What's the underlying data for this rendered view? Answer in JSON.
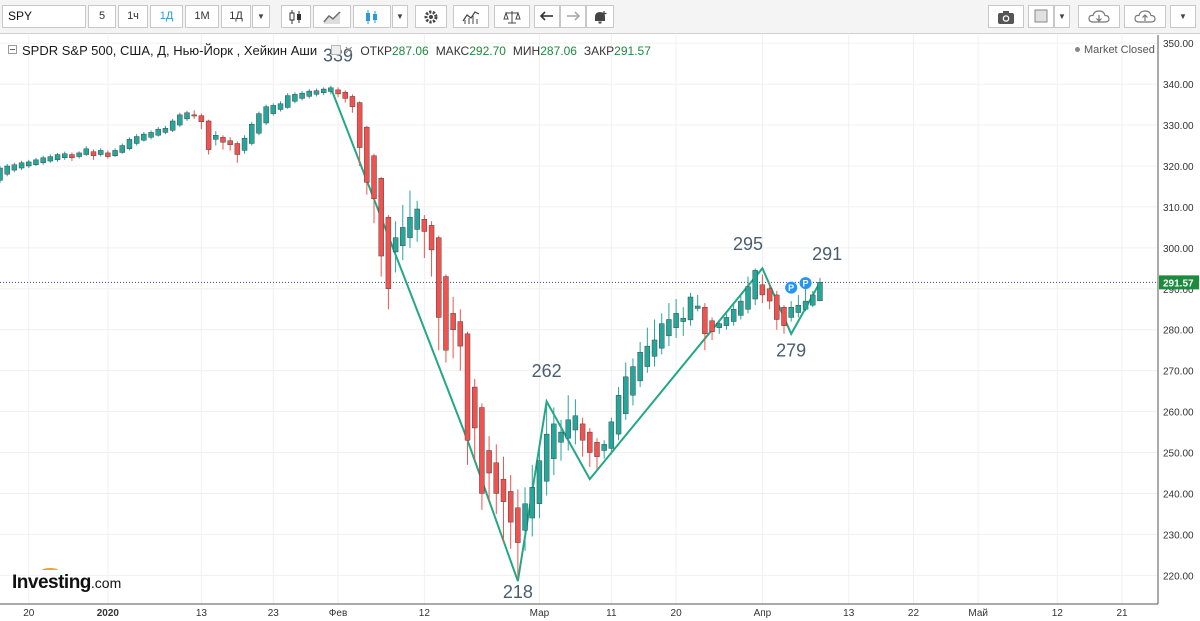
{
  "toolbar": {
    "symbol": "SPY",
    "intervals": [
      "5",
      "1ч",
      "1Д",
      "1М",
      "1Д"
    ],
    "active_interval": "1Д"
  },
  "legend": {
    "title": "SPDR S&P 500, США, Д, Нью-Йорк , Хейкин Аши",
    "open_label": "ОТКР",
    "open_value": "287.06",
    "high_label": "МАКС",
    "high_value": "292.70",
    "low_label": "МИН",
    "low_value": "287.06",
    "close_label": "ЗАКР",
    "close_value": "291.57"
  },
  "market_status": "Market Closed",
  "logo": {
    "name": "Investing",
    "suffix": ".com"
  },
  "colors": {
    "up": "#26a69a",
    "down": "#ef5350",
    "wave_line": "#22a884",
    "price_marker": "#1e8a3d",
    "annotation_text": "#4a5d6e",
    "badge": "#2196f3"
  },
  "chart_data": {
    "type": "candlestick",
    "style": "Heikin Ashi",
    "ylim": [
      213,
      352
    ],
    "y_ticks": [
      220,
      230,
      240,
      250,
      260,
      270,
      280,
      290,
      300,
      310,
      320,
      330,
      340,
      350
    ],
    "y_tick_labels": [
      "220.00",
      "230.00",
      "240.00",
      "250.00",
      "260.00",
      "270.00",
      "280.00",
      "290.00",
      "300.00",
      "310.00",
      "320.00",
      "330.00",
      "340.00",
      "350.00"
    ],
    "x_ticks": [
      {
        "label": "20",
        "day": 0
      },
      {
        "label": "2020",
        "day": 11,
        "bold": true
      },
      {
        "label": "13",
        "day": 24
      },
      {
        "label": "23",
        "day": 34
      },
      {
        "label": "Фев",
        "day": 43
      },
      {
        "label": "12",
        "day": 55
      },
      {
        "label": "Мар",
        "day": 71
      },
      {
        "label": "11",
        "day": 81
      },
      {
        "label": "20",
        "day": 90
      },
      {
        "label": "Апр",
        "day": 102
      },
      {
        "label": "13",
        "day": 114
      },
      {
        "label": "22",
        "day": 123
      },
      {
        "label": "Май",
        "day": 132
      },
      {
        "label": "12",
        "day": 143
      },
      {
        "label": "21",
        "day": 152
      }
    ],
    "x_range_days": [
      -4,
      157
    ],
    "candles": [
      {
        "d": -4,
        "o": 316.5,
        "c": 319.5,
        "h": 320.0,
        "l": 315.8
      },
      {
        "d": -3,
        "o": 318.0,
        "c": 320.0,
        "h": 320.5,
        "l": 317.5
      },
      {
        "d": -2,
        "o": 319.0,
        "c": 320.3,
        "h": 320.8,
        "l": 318.5
      },
      {
        "d": -1,
        "o": 319.5,
        "c": 320.8,
        "h": 321.3,
        "l": 319.0
      },
      {
        "d": 0,
        "o": 320.0,
        "c": 321.0,
        "h": 321.5,
        "l": 319.5
      },
      {
        "d": 1,
        "o": 320.3,
        "c": 321.5,
        "h": 322.0,
        "l": 320.0
      },
      {
        "d": 2,
        "o": 320.8,
        "c": 322.0,
        "h": 322.5,
        "l": 320.3
      },
      {
        "d": 3,
        "o": 321.2,
        "c": 322.3,
        "h": 322.8,
        "l": 320.8
      },
      {
        "d": 4,
        "o": 321.5,
        "c": 322.8,
        "h": 323.2,
        "l": 321.0
      },
      {
        "d": 5,
        "o": 322.0,
        "c": 323.0,
        "h": 323.5,
        "l": 321.5
      },
      {
        "d": 6,
        "o": 322.8,
        "c": 322.0,
        "h": 323.3,
        "l": 321.2
      },
      {
        "d": 7,
        "o": 322.3,
        "c": 323.2,
        "h": 323.6,
        "l": 321.8
      },
      {
        "d": 8,
        "o": 322.8,
        "c": 324.2,
        "h": 324.8,
        "l": 322.5
      },
      {
        "d": 9,
        "o": 323.5,
        "c": 322.5,
        "h": 324.0,
        "l": 321.5
      },
      {
        "d": 10,
        "o": 322.8,
        "c": 323.8,
        "h": 324.3,
        "l": 322.3
      },
      {
        "d": 11,
        "o": 323.2,
        "c": 322.3,
        "h": 323.8,
        "l": 321.8
      },
      {
        "d": 12,
        "o": 322.5,
        "c": 323.8,
        "h": 324.3,
        "l": 322.2
      },
      {
        "d": 13,
        "o": 323.3,
        "c": 325.0,
        "h": 325.5,
        "l": 323.0
      },
      {
        "d": 14,
        "o": 324.2,
        "c": 326.5,
        "h": 327.0,
        "l": 323.8
      },
      {
        "d": 15,
        "o": 325.5,
        "c": 327.2,
        "h": 327.8,
        "l": 325.0
      },
      {
        "d": 16,
        "o": 326.3,
        "c": 327.8,
        "h": 328.3,
        "l": 326.0
      },
      {
        "d": 17,
        "o": 327.0,
        "c": 328.2,
        "h": 328.7,
        "l": 326.5
      },
      {
        "d": 18,
        "o": 327.5,
        "c": 329.0,
        "h": 329.5,
        "l": 327.2
      },
      {
        "d": 19,
        "o": 328.2,
        "c": 329.2,
        "h": 329.8,
        "l": 327.8
      },
      {
        "d": 20,
        "o": 328.7,
        "c": 331.0,
        "h": 331.5,
        "l": 328.3
      },
      {
        "d": 21,
        "o": 330.0,
        "c": 332.5,
        "h": 333.0,
        "l": 329.5
      },
      {
        "d": 22,
        "o": 331.5,
        "c": 333.0,
        "h": 333.5,
        "l": 331.0
      },
      {
        "d": 23,
        "o": 332.5,
        "c": 332.2,
        "h": 333.6,
        "l": 331.5
      },
      {
        "d": 24,
        "o": 332.3,
        "c": 330.8,
        "h": 332.8,
        "l": 329.0
      },
      {
        "d": 25,
        "o": 331.0,
        "c": 324.0,
        "h": 331.3,
        "l": 322.8
      },
      {
        "d": 26,
        "o": 326.5,
        "c": 327.5,
        "h": 328.5,
        "l": 325.0
      },
      {
        "d": 27,
        "o": 327.0,
        "c": 325.8,
        "h": 327.5,
        "l": 324.0
      },
      {
        "d": 28,
        "o": 326.2,
        "c": 325.2,
        "h": 327.0,
        "l": 323.8
      },
      {
        "d": 29,
        "o": 325.5,
        "c": 322.8,
        "h": 326.0,
        "l": 320.8
      },
      {
        "d": 30,
        "o": 323.8,
        "c": 326.8,
        "h": 327.5,
        "l": 323.0
      },
      {
        "d": 31,
        "o": 325.5,
        "c": 330.2,
        "h": 330.8,
        "l": 325.0
      },
      {
        "d": 32,
        "o": 328.0,
        "c": 332.8,
        "h": 333.3,
        "l": 327.5
      },
      {
        "d": 33,
        "o": 330.5,
        "c": 334.5,
        "h": 335.0,
        "l": 330.0
      },
      {
        "d": 34,
        "o": 332.8,
        "c": 334.8,
        "h": 335.3,
        "l": 332.3
      },
      {
        "d": 35,
        "o": 333.8,
        "c": 335.2,
        "h": 335.8,
        "l": 333.3
      },
      {
        "d": 36,
        "o": 334.3,
        "c": 337.2,
        "h": 337.8,
        "l": 334.0
      },
      {
        "d": 37,
        "o": 335.8,
        "c": 337.5,
        "h": 338.0,
        "l": 335.3
      },
      {
        "d": 38,
        "o": 336.5,
        "c": 337.8,
        "h": 338.3,
        "l": 336.0
      },
      {
        "d": 39,
        "o": 337.0,
        "c": 338.3,
        "h": 338.8,
        "l": 336.5
      },
      {
        "d": 40,
        "o": 337.5,
        "c": 338.4,
        "h": 338.9,
        "l": 337.0
      },
      {
        "d": 41,
        "o": 337.9,
        "c": 338.8,
        "h": 339.2,
        "l": 337.3
      },
      {
        "d": 42,
        "o": 338.2,
        "c": 339.1,
        "h": 339.6,
        "l": 337.5
      },
      {
        "d": 43,
        "o": 338.6,
        "c": 337.6,
        "h": 339.2,
        "l": 336.8
      },
      {
        "d": 44,
        "o": 338.0,
        "c": 336.5,
        "h": 338.5,
        "l": 335.5
      },
      {
        "d": 45,
        "o": 337.0,
        "c": 334.5,
        "h": 337.5,
        "l": 333.0
      },
      {
        "d": 46,
        "o": 335.5,
        "c": 324.5,
        "h": 335.8,
        "l": 320.0
      },
      {
        "d": 47,
        "o": 329.5,
        "c": 316.0,
        "h": 329.8,
        "l": 313.0
      },
      {
        "d": 48,
        "o": 322.5,
        "c": 312.0,
        "h": 323.0,
        "l": 306.0
      },
      {
        "d": 49,
        "o": 317.0,
        "c": 298.0,
        "h": 317.3,
        "l": 293.0
      },
      {
        "d": 50,
        "o": 307.5,
        "c": 290.0,
        "h": 308.0,
        "l": 285.0
      },
      {
        "d": 51,
        "o": 299.0,
        "c": 302.5,
        "h": 306.5,
        "l": 294.0
      },
      {
        "d": 52,
        "o": 300.5,
        "c": 305.0,
        "h": 310.5,
        "l": 297.0
      },
      {
        "d": 53,
        "o": 302.5,
        "c": 307.5,
        "h": 314.0,
        "l": 300.0
      },
      {
        "d": 54,
        "o": 304.5,
        "c": 309.5,
        "h": 311.5,
        "l": 301.5
      },
      {
        "d": 55,
        "o": 307.0,
        "c": 304.0,
        "h": 308.0,
        "l": 297.5
      },
      {
        "d": 56,
        "o": 305.5,
        "c": 299.5,
        "h": 306.5,
        "l": 293.0
      },
      {
        "d": 57,
        "o": 302.5,
        "c": 283.0,
        "h": 303.0,
        "l": 275.0
      },
      {
        "d": 58,
        "o": 293.0,
        "c": 275.0,
        "h": 293.5,
        "l": 272.0
      },
      {
        "d": 59,
        "o": 284.0,
        "c": 280.0,
        "h": 288.0,
        "l": 273.0
      },
      {
        "d": 60,
        "o": 282.0,
        "c": 276.0,
        "h": 285.0,
        "l": 270.0
      },
      {
        "d": 61,
        "o": 279.0,
        "c": 253.0,
        "h": 279.5,
        "l": 247.0
      },
      {
        "d": 62,
        "o": 266.0,
        "c": 256.0,
        "h": 268.0,
        "l": 248.0
      },
      {
        "d": 63,
        "o": 261.0,
        "c": 240.0,
        "h": 262.0,
        "l": 236.0
      },
      {
        "d": 64,
        "o": 250.5,
        "c": 245.0,
        "h": 254.0,
        "l": 238.0
      },
      {
        "d": 65,
        "o": 247.5,
        "c": 240.0,
        "h": 252.0,
        "l": 235.0
      },
      {
        "d": 66,
        "o": 243.5,
        "c": 238.0,
        "h": 249.0,
        "l": 228.0
      },
      {
        "d": 67,
        "o": 240.5,
        "c": 233.0,
        "h": 244.5,
        "l": 226.5
      },
      {
        "d": 68,
        "o": 236.5,
        "c": 228.0,
        "h": 241.0,
        "l": 219.5
      },
      {
        "d": 69,
        "o": 231.0,
        "c": 237.5,
        "h": 241.5,
        "l": 226.0
      },
      {
        "d": 70,
        "o": 234.0,
        "c": 241.5,
        "h": 247.0,
        "l": 229.5
      },
      {
        "d": 71,
        "o": 237.5,
        "c": 248.0,
        "h": 251.5,
        "l": 234.0
      },
      {
        "d": 72,
        "o": 243.0,
        "c": 254.5,
        "h": 262.5,
        "l": 239.5
      },
      {
        "d": 73,
        "o": 248.5,
        "c": 257.0,
        "h": 261.0,
        "l": 244.5
      },
      {
        "d": 74,
        "o": 252.5,
        "c": 255.0,
        "h": 258.0,
        "l": 248.0
      },
      {
        "d": 75,
        "o": 253.5,
        "c": 258.0,
        "h": 264.0,
        "l": 250.5
      },
      {
        "d": 76,
        "o": 255.5,
        "c": 259.0,
        "h": 263.0,
        "l": 252.0
      },
      {
        "d": 77,
        "o": 257.0,
        "c": 253.0,
        "h": 258.5,
        "l": 249.0
      },
      {
        "d": 78,
        "o": 255.0,
        "c": 250.0,
        "h": 256.0,
        "l": 246.5
      },
      {
        "d": 79,
        "o": 252.5,
        "c": 249.0,
        "h": 253.5,
        "l": 246.0
      },
      {
        "d": 80,
        "o": 250.5,
        "c": 252.0,
        "h": 253.0,
        "l": 248.5
      },
      {
        "d": 81,
        "o": 251.0,
        "c": 257.5,
        "h": 258.5,
        "l": 249.5
      },
      {
        "d": 82,
        "o": 254.5,
        "c": 264.0,
        "h": 266.0,
        "l": 253.0
      },
      {
        "d": 83,
        "o": 259.5,
        "c": 268.5,
        "h": 272.0,
        "l": 258.0
      },
      {
        "d": 84,
        "o": 264.0,
        "c": 271.0,
        "h": 273.0,
        "l": 261.5
      },
      {
        "d": 85,
        "o": 267.5,
        "c": 274.5,
        "h": 277.0,
        "l": 266.0
      },
      {
        "d": 86,
        "o": 271.0,
        "c": 276.0,
        "h": 280.5,
        "l": 269.5
      },
      {
        "d": 87,
        "o": 273.5,
        "c": 277.5,
        "h": 282.5,
        "l": 271.0
      },
      {
        "d": 88,
        "o": 275.5,
        "c": 281.5,
        "h": 284.0,
        "l": 274.0
      },
      {
        "d": 89,
        "o": 278.5,
        "c": 282.5,
        "h": 286.5,
        "l": 276.0
      },
      {
        "d": 90,
        "o": 280.5,
        "c": 284.0,
        "h": 287.5,
        "l": 278.0
      },
      {
        "d": 91,
        "o": 282.0,
        "c": 282.8,
        "h": 285.5,
        "l": 278.5
      },
      {
        "d": 92,
        "o": 282.4,
        "c": 288.0,
        "h": 289.0,
        "l": 281.0
      },
      {
        "d": 93,
        "o": 285.2,
        "c": 285.8,
        "h": 288.5,
        "l": 284.5
      },
      {
        "d": 94,
        "o": 285.5,
        "c": 279.0,
        "h": 286.5,
        "l": 275.0
      },
      {
        "d": 95,
        "o": 282.2,
        "c": 279.5,
        "h": 283.0,
        "l": 277.5
      },
      {
        "d": 96,
        "o": 280.5,
        "c": 281.5,
        "h": 282.5,
        "l": 279.0
      },
      {
        "d": 97,
        "o": 281.0,
        "c": 283.0,
        "h": 284.0,
        "l": 280.0
      },
      {
        "d": 98,
        "o": 282.0,
        "c": 285.0,
        "h": 286.5,
        "l": 281.0
      },
      {
        "d": 99,
        "o": 283.5,
        "c": 287.0,
        "h": 288.5,
        "l": 282.5
      },
      {
        "d": 100,
        "o": 285.0,
        "c": 290.5,
        "h": 293.0,
        "l": 284.0
      },
      {
        "d": 101,
        "o": 287.5,
        "c": 294.5,
        "h": 295.0,
        "l": 286.0
      },
      {
        "d": 102,
        "o": 291.0,
        "c": 288.5,
        "h": 293.5,
        "l": 286.5
      },
      {
        "d": 103,
        "o": 290.0,
        "c": 287.0,
        "h": 291.5,
        "l": 285.0
      },
      {
        "d": 104,
        "o": 288.5,
        "c": 282.5,
        "h": 289.5,
        "l": 280.0
      },
      {
        "d": 105,
        "o": 285.5,
        "c": 281.0,
        "h": 286.0,
        "l": 279.0
      },
      {
        "d": 106,
        "o": 283.0,
        "c": 285.5,
        "h": 287.0,
        "l": 282.0
      },
      {
        "d": 107,
        "o": 284.2,
        "c": 286.0,
        "h": 288.5,
        "l": 283.0
      },
      {
        "d": 108,
        "o": 285.0,
        "c": 287.0,
        "h": 290.0,
        "l": 284.5
      },
      {
        "d": 109,
        "o": 286.0,
        "c": 288.5,
        "h": 289.5,
        "l": 285.5
      },
      {
        "d": 110,
        "o": 287.06,
        "c": 291.57,
        "h": 292.7,
        "l": 287.06
      }
    ],
    "wave_points": [
      {
        "d": 42,
        "price": 339.1
      },
      {
        "d": 61,
        "price": 253.0
      },
      {
        "d": 68,
        "price": 218.6
      },
      {
        "d": 72,
        "price": 262.5
      },
      {
        "d": 78,
        "price": 243.5
      },
      {
        "d": 102,
        "price": 295.0
      },
      {
        "d": 106,
        "price": 279.0
      },
      {
        "d": 110,
        "price": 291.57
      }
    ],
    "wave_labels": [
      {
        "text": "339",
        "d": 43,
        "price": 345.5
      },
      {
        "text": "218",
        "d": 68,
        "price": 214.5
      },
      {
        "text": "262",
        "d": 72,
        "price": 268.5
      },
      {
        "text": "295",
        "d": 100,
        "price": 299.5
      },
      {
        "text": "279",
        "d": 106,
        "price": 273.5
      },
      {
        "text": "291",
        "d": 111,
        "price": 297.0
      }
    ],
    "badges": [
      {
        "text": "P",
        "d": 106,
        "price": 290.3
      },
      {
        "text": "P",
        "d": 108,
        "price": 291.4
      }
    ],
    "last_price": 291.57,
    "last_price_label": "291.57"
  }
}
